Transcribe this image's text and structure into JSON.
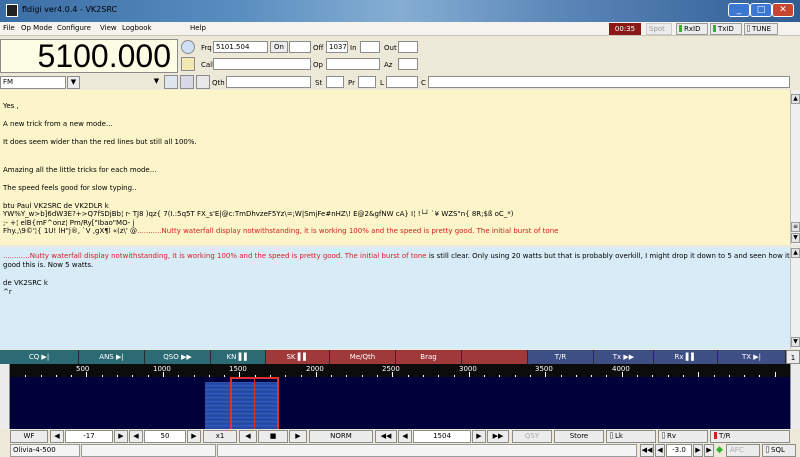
{
  "window": {
    "title": "fldigi ver4.0.4 - VK2SRC"
  },
  "menu": [
    "File",
    "Op Mode",
    "Configure",
    "View",
    "Logbook",
    "Help"
  ],
  "top_status": {
    "clock": "00:35",
    "spot": "Spot",
    "rxid": "RxID",
    "txid": "TxID",
    "tune": "TUNE"
  },
  "freq": {
    "display": "5100.000",
    "frq_label": "Frq",
    "frq_value": "5101.504",
    "on_label": "On",
    "off_label": "Off",
    "off_value": "1037",
    "in_label": "In",
    "out_label": "Out",
    "call_label": "Call",
    "op_label": "Op",
    "az_label": "Az",
    "qth_label": "Qth",
    "st_label": "St",
    "pr_label": "Pr",
    "l_label": "L",
    "c_label": "C",
    "mode": "FM"
  },
  "rx_text": [
    {
      "text": "Yes ,",
      "red": false
    },
    {
      "text": "A new trick from a new mode...",
      "red": false
    },
    {
      "text": "It does seem wider than the red lines but still all 100%.",
      "red": false
    },
    {
      "text": "Amazing all the little tricks for each mode...",
      "red": false
    },
    {
      "text": "The speed feels good for slow typing..",
      "red": false
    },
    {
      "text": " btu Paul VK2SRC de VK2DLR k",
      "red": false
    },
    {
      "text": "YW%Y_w>b]6dW3E?+>Q7fSDjBb¦ r- TJ8 )qz{ 7(I.:5q5T    FX_s'E|@c:TmDhvzeF5Yz\\=;W|SmjFe#nHZ\\! E@2&gfNW cA} I¦ !└┘  `¥ WZS\"n{ 8R;$ß oC_*)",
      "red": false
    },
    {
      "text": ";- +¦ elB{mF^onz¦ Pm/Ry[\"Ibao\"MO- j",
      "red": false
    },
    {
      "text_black": "Fhy.,\\9©'¦{  1U!  lH\"j®, `V  ,gX¶l  «(z\\' @",
      "text_red": "...........Nutty waterfall display notwithstanding, it is working 100% and the speed is pretty good.  The initial burst of tone",
      "mixed": true
    }
  ],
  "tx_text": {
    "line1_red": "............Nutty waterfall display notwithstanding, it is working 100% and the speed is pretty good.  The initial burst of tone",
    "line1_black": " is still clear.  Only using 20 watts but that is probably overkill, I might drop it down to 5 and seen how it goes",
    "line2": "good this is. Now 5 watts.",
    "line3": "de VK2SRC k",
    "line4": "^r"
  },
  "macros": [
    {
      "label": "CQ ▶|",
      "color": "#2c6b74"
    },
    {
      "label": "ANS ▶|",
      "color": "#2c6b74"
    },
    {
      "label": "QSO ▶▶",
      "color": "#2c6b74"
    },
    {
      "label": "KN ▌▌",
      "color": "#2c6b74"
    },
    {
      "label": "SK ▌▌",
      "color": "#a03a3a"
    },
    {
      "label": "Me/Qth",
      "color": "#a03a3a"
    },
    {
      "label": "Brag",
      "color": "#a03a3a"
    },
    {
      "label": "",
      "color": "#a03a3a"
    },
    {
      "label": "T/R",
      "color": "#3e4f86"
    },
    {
      "label": "Tx ▶▶",
      "color": "#3e4f86"
    },
    {
      "label": "Rx ▌▌",
      "color": "#3e4f86"
    },
    {
      "label": "TX ▶|",
      "color": "#3e4f86"
    }
  ],
  "macro_page": "1",
  "wf_ticks": [
    "500",
    "1000",
    "1500",
    "2000",
    "2500",
    "3000",
    "3500",
    "4000"
  ],
  "controls": {
    "wf": "WF",
    "ref": "-17",
    "range": "50",
    "zoom": "x1",
    "speed": "NORM",
    "carrier": "1504",
    "qsy": "QSY",
    "store": "Store",
    "lk": "Lk",
    "rv": "Rv",
    "tr": "T/R"
  },
  "status": {
    "mode": "Olivia-4-500",
    "afc_val": "-3.0",
    "afc": "AFC",
    "sql": "SQL"
  }
}
